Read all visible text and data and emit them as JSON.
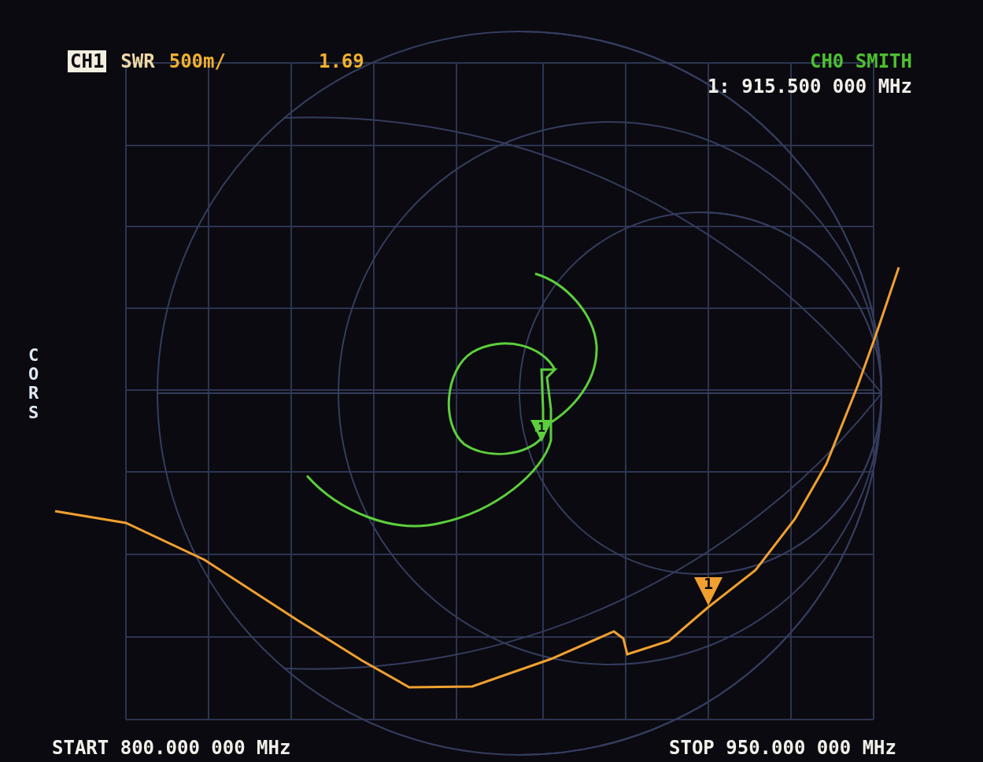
{
  "header": {
    "channel": {
      "label": "CH1",
      "selected": true
    },
    "format": "SWR",
    "scale": "500m/",
    "value": "1.69",
    "trace2": "CH0 SMITH",
    "marker_readout": "1: 915.500 000 MHz"
  },
  "side_label": "CORS",
  "markers": [
    {
      "label": "1"
    },
    {
      "label": "1"
    }
  ],
  "footer": {
    "start": "START 800.000 000 MHz",
    "stop": "STOP 950.000 000 MHz"
  }
}
